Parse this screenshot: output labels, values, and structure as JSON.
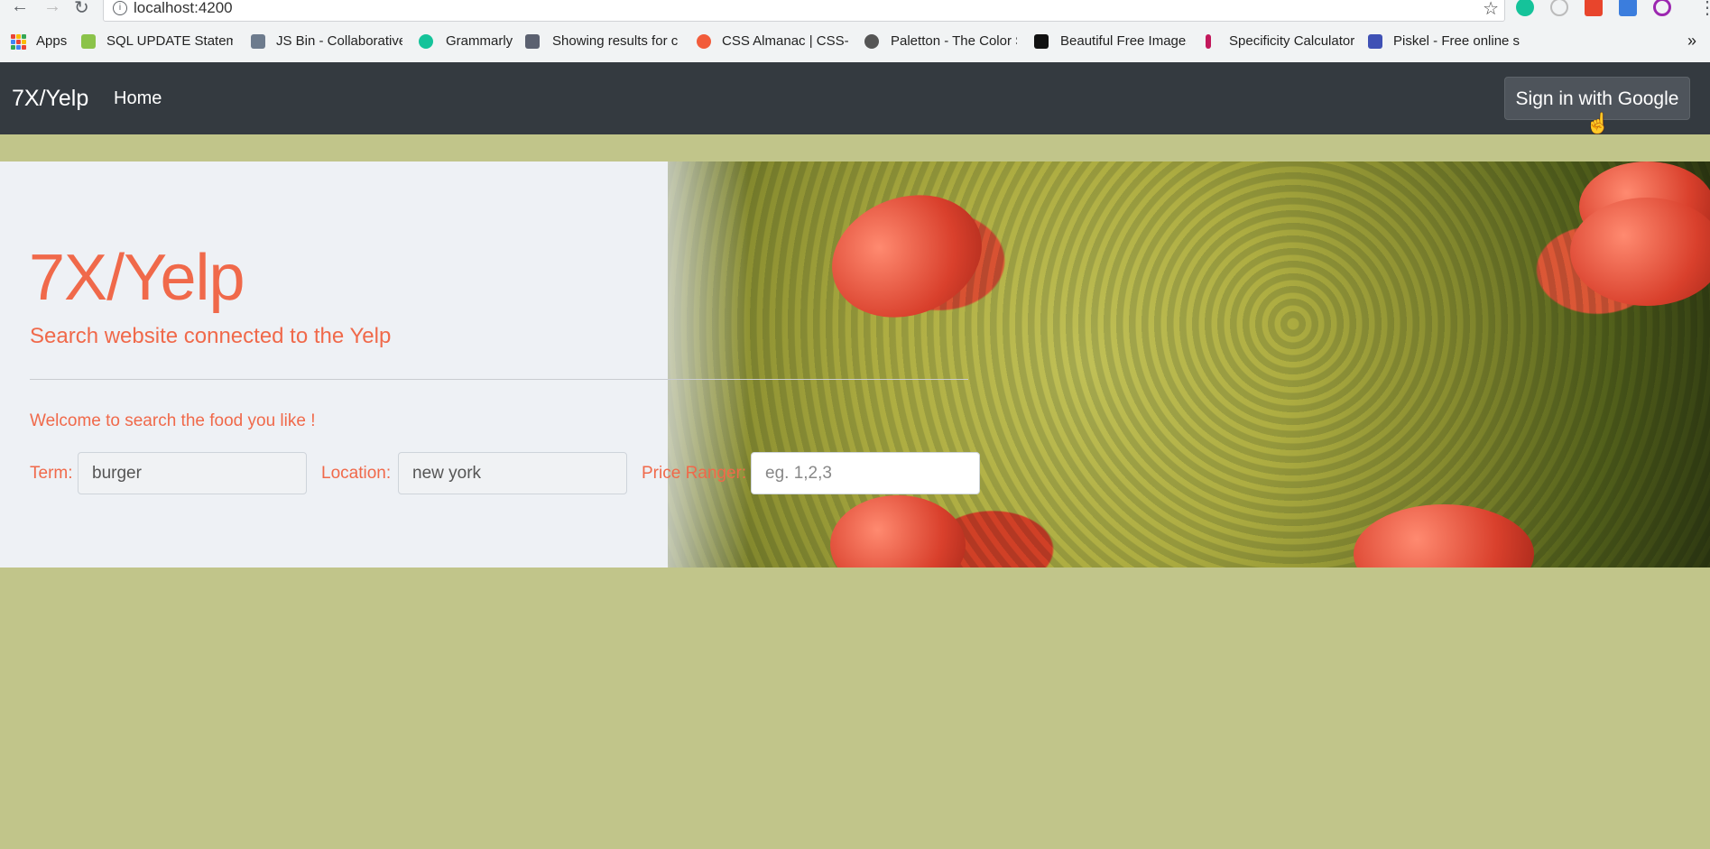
{
  "browser": {
    "url": "localhost:4200",
    "bookmarks": [
      {
        "label": "Apps",
        "color": "#4285f4"
      },
      {
        "label": "SQL UPDATE Stateme",
        "color": "#8bc34a"
      },
      {
        "label": "JS Bin - Collaborative",
        "color": "#6d7b8d"
      },
      {
        "label": "Grammarly",
        "color": "#15c39a"
      },
      {
        "label": "Showing results for c",
        "color": "#5b6170"
      },
      {
        "label": "CSS Almanac | CSS-Tr",
        "color": "#f25c3b"
      },
      {
        "label": "Paletton - The Color S",
        "color": "#555555"
      },
      {
        "label": "Beautiful Free Images",
        "color": "#111111"
      },
      {
        "label": "Specificity Calculator",
        "color": "#c2185b"
      },
      {
        "label": "Piskel - Free online sp",
        "color": "#3f51b5"
      }
    ]
  },
  "navbar": {
    "brand": "7X/Yelp",
    "home": "Home",
    "signin": "Sign in with Google"
  },
  "hero": {
    "title": "7X/Yelp",
    "subtitle": "Search website connected to the Yelp",
    "welcome": "Welcome to search the food you like !"
  },
  "search": {
    "term_label": "Term:",
    "term_value": "burger",
    "location_label": "Location:",
    "location_value": "new york",
    "price_label": "Price Ranger:",
    "price_placeholder": "eg. 1,2,3"
  },
  "colors": {
    "accent": "#f0694a",
    "navbar": "#343a40",
    "page_bg": "#c1c58a"
  }
}
